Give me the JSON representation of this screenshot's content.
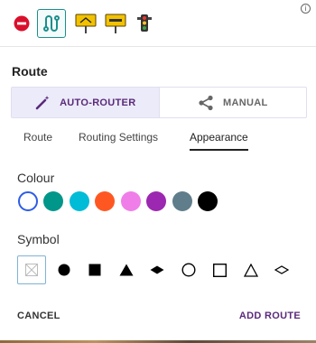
{
  "toolbar": {
    "items": [
      {
        "name": "no-entry-icon"
      },
      {
        "name": "route-icon"
      },
      {
        "name": "direction-sign-icon"
      },
      {
        "name": "custom-sign-icon"
      },
      {
        "name": "traffic-light-icon"
      }
    ],
    "info_icon": "i"
  },
  "route": {
    "title": "Route",
    "modes": {
      "auto_label": "AUTO-ROUTER",
      "manual_label": "MANUAL"
    }
  },
  "tabs": [
    "Route",
    "Routing Settings",
    "Appearance"
  ],
  "colour": {
    "label": "Colour",
    "swatches": [
      "#ffffff",
      "#00968a",
      "#00bcd6",
      "#ff5722",
      "#f07ee8",
      "#9c27b0",
      "#607d8b",
      "#000000"
    ]
  },
  "symbol": {
    "label": "Symbol",
    "items": [
      "none",
      "circle-filled",
      "square-filled",
      "triangle-filled",
      "diamond-filled",
      "circle-outline",
      "square-outline",
      "triangle-outline",
      "diamond-outline"
    ]
  },
  "footer": {
    "cancel_label": "CANCEL",
    "add_label": "ADD ROUTE"
  },
  "colors": {
    "accent": "#5a2a7a",
    "selection_blue": "#2e5ce6",
    "teal": "#1a8f8c"
  }
}
